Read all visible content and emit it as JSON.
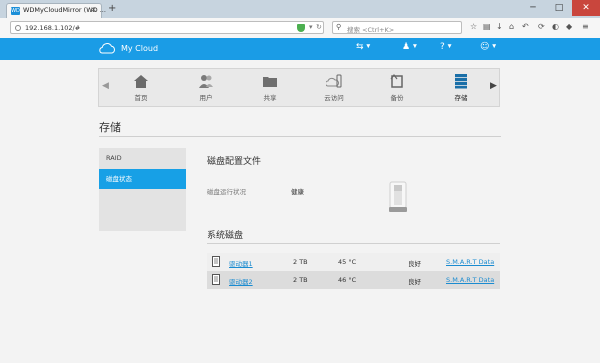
{
  "browser": {
    "tab_title": "WDMyCloudMirror (WD ...",
    "tab_logo": "WD",
    "url": "192.168.1.102/#",
    "search_placeholder": "搜索 <Ctrl+K>",
    "new_tab": "+",
    "controls": {
      "minimize": "─",
      "maximize": "□",
      "close": "✕"
    }
  },
  "header": {
    "brand": "My Cloud",
    "icons": [
      "usb-icon",
      "bell-icon",
      "help-icon",
      "user-icon"
    ],
    "accent": "#1a9ce6"
  },
  "nav": {
    "items": [
      {
        "label": "首页",
        "icon": "home-icon"
      },
      {
        "label": "用户",
        "icon": "users-icon"
      },
      {
        "label": "共享",
        "icon": "folder-icon"
      },
      {
        "label": "云访问",
        "icon": "cloud-device-icon"
      },
      {
        "label": "备份",
        "icon": "backup-icon"
      },
      {
        "label": "存储",
        "icon": "storage-icon",
        "active": true
      }
    ]
  },
  "page": {
    "title": "存储"
  },
  "sidebar": {
    "items": [
      {
        "label": "RAID"
      },
      {
        "label": "磁盘状态",
        "active": true
      }
    ]
  },
  "profile": {
    "heading": "磁盘配置文件",
    "status_label": "磁盘运行状况",
    "status_value": "健康"
  },
  "disks": {
    "heading": "系统磁盘",
    "rows": [
      {
        "name": "驱动器1",
        "size": "2 TB",
        "temp": "45 °C",
        "health": "良好",
        "link": "S.M.A.R.T Data"
      },
      {
        "name": "驱动器2",
        "size": "2 TB",
        "temp": "46 °C",
        "health": "良好",
        "link": "S.M.A.R.T Data"
      }
    ]
  }
}
